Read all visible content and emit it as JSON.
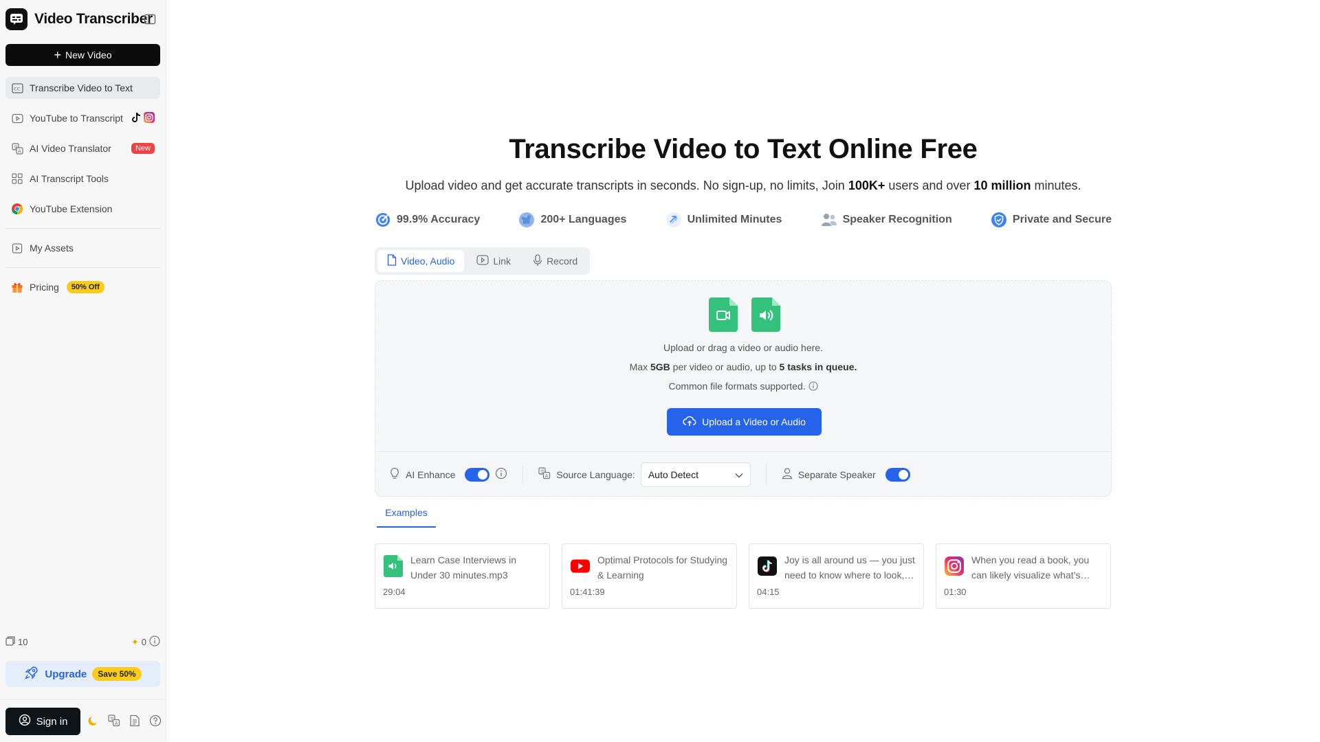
{
  "app": {
    "title": "Video Transcriber"
  },
  "sidebar": {
    "new_video_label": "New Video",
    "items": [
      {
        "label": "Transcribe Video to Text",
        "icon": "cc-icon"
      },
      {
        "label": "YouTube to Transcript",
        "icon": "play-icon"
      },
      {
        "label": "AI Video Translator",
        "icon": "translate-icon",
        "badge": "New"
      },
      {
        "label": "AI Transcript Tools",
        "icon": "grid-icon"
      },
      {
        "label": "YouTube Extension",
        "icon": "chrome-icon"
      },
      {
        "label": "My Assets",
        "icon": "assets-icon"
      },
      {
        "label": "Pricing",
        "icon": "gift-icon",
        "badge": "50% Off"
      }
    ],
    "credits": {
      "files": "10",
      "ai": "0"
    },
    "upgrade": {
      "label": "Upgrade",
      "badge": "Save 50%"
    },
    "signin_label": "Sign in"
  },
  "main": {
    "title": "Transcribe Video to Text Online Free",
    "subtitle_pre": "Upload video and get accurate transcripts in seconds. No sign-up, no limits, Join ",
    "subtitle_users": "100K+",
    "subtitle_mid": " users and over ",
    "subtitle_minutes": "10 million",
    "subtitle_post": " minutes.",
    "features": [
      {
        "label": "99.9% Accuracy",
        "icon": "accuracy-icon"
      },
      {
        "label": "200+ Languages",
        "icon": "globe-icon"
      },
      {
        "label": "Unlimited Minutes",
        "icon": "infinity-icon"
      },
      {
        "label": "Speaker Recognition",
        "icon": "people-icon"
      },
      {
        "label": "Private and Secure",
        "icon": "shield-icon"
      }
    ],
    "tabs": [
      {
        "label": "Video, Audio",
        "active": true
      },
      {
        "label": "Link",
        "active": false
      },
      {
        "label": "Record",
        "active": false
      }
    ],
    "upload": {
      "line1": "Upload or drag a video or audio here.",
      "line2_pre": "Max ",
      "line2_size": "5GB",
      "line2_mid": " per video or audio, up to ",
      "line2_tasks": "5 tasks in queue.",
      "line3": "Common file formats supported.",
      "button_label": "Upload a Video or Audio"
    },
    "options": {
      "ai_enhance_label": "AI Enhance",
      "ai_enhance_on": true,
      "source_language_label": "Source Language:",
      "source_language_value": "Auto Detect",
      "separate_speaker_label": "Separate Speaker",
      "separate_speaker_on": true
    },
    "examples_tab": "Examples",
    "examples": [
      {
        "title": "Learn Case Interviews in Under 30 minutes.mp3",
        "duration": "29:04",
        "icon": "audio-file-icon"
      },
      {
        "title": "Optimal Protocols for Studying & Learning",
        "duration": "01:41:39",
        "icon": "youtube-icon"
      },
      {
        "title": "Joy is all around us — you just need to know where to look, and how to see it",
        "duration": "04:15",
        "icon": "tiktok-icon"
      },
      {
        "title": "When you read a book, you can likely visualize what’s happening",
        "duration": "01:30",
        "icon": "instagram-icon"
      }
    ]
  },
  "colors": {
    "accent": "#2563eb",
    "green": "#34c17c",
    "badge_red": "#ef4444",
    "badge_yellow": "#facc15"
  }
}
